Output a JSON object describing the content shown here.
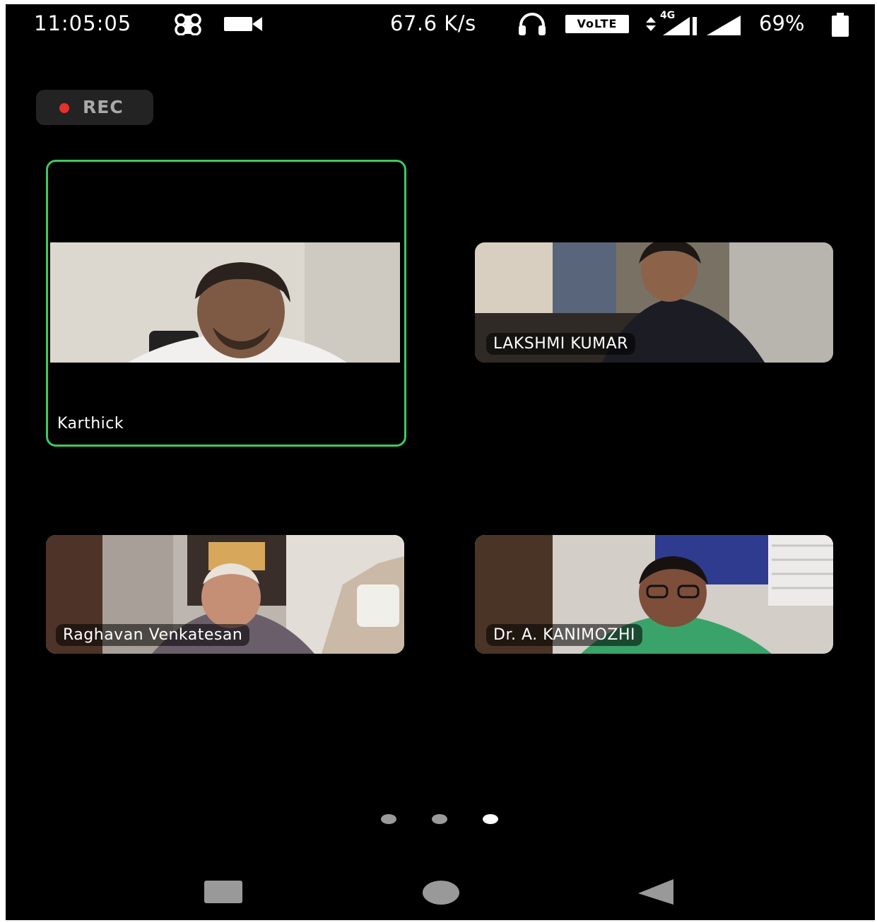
{
  "status_bar": {
    "time": "11:05:05",
    "net_speed": "67.6 K/s",
    "volte": "VoLTE",
    "network_type": "4G",
    "battery": "69%"
  },
  "recording": {
    "label": "REC",
    "color": "#e4322b"
  },
  "participants": [
    {
      "name": "Karthick",
      "active_speaker": true
    },
    {
      "name": "LAKSHMI KUMAR",
      "active_speaker": false
    },
    {
      "name": "Raghavan Venkatesan",
      "active_speaker": false
    },
    {
      "name": "Dr. A. KANIMOZHI",
      "active_speaker": false
    }
  ],
  "page_indicator": {
    "total": 3,
    "current": 3
  },
  "nav": {
    "recents": "recents-button",
    "home": "home-button",
    "back": "back-button"
  },
  "colors": {
    "active_border": "#3ec95b",
    "background": "#000000"
  }
}
